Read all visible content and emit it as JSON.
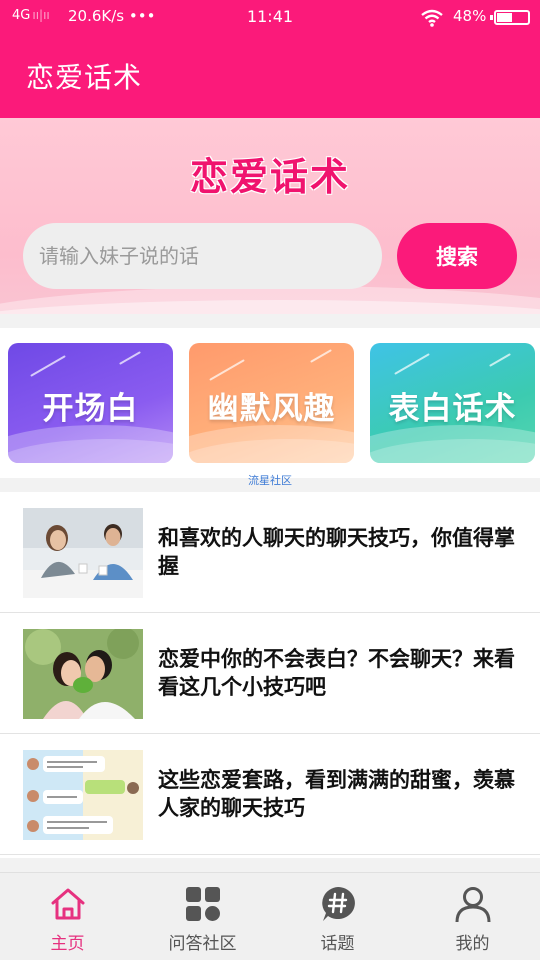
{
  "status_bar": {
    "network": "4G",
    "speed": "20.6K/s",
    "more": "•••",
    "time": "11:41",
    "battery": "48%"
  },
  "app_bar": {
    "title": "恋爱话术"
  },
  "banner": {
    "title": "恋爱话术",
    "search_placeholder": "请输入妹子说的话",
    "search_button": "搜索"
  },
  "categories": [
    {
      "label": "开场白",
      "color": "#7a52ea"
    },
    {
      "label": "幽默风趣",
      "color": "#ffa674"
    },
    {
      "label": "表白话术",
      "color": "#3cc6c4"
    }
  ],
  "ad_label": "流星社区",
  "articles": [
    {
      "title": "和喜欢的人聊天的聊天技巧，你值得掌握",
      "thumb_icon": "couple-cafe-photo"
    },
    {
      "title": "恋爱中你的不会表白？不会聊天？来看看这几个小技巧吧",
      "thumb_icon": "couple-kiss-photo"
    },
    {
      "title": "这些恋爱套路，看到满满的甜蜜，羡慕人家的聊天技巧",
      "thumb_icon": "chat-screenshot-photo"
    }
  ],
  "tabs": [
    {
      "label": "主页",
      "icon": "home-icon",
      "active": true
    },
    {
      "label": "问答社区",
      "icon": "grid-icon",
      "active": false
    },
    {
      "label": "话题",
      "icon": "hashtag-icon",
      "active": false
    },
    {
      "label": "我的",
      "icon": "person-icon",
      "active": false
    }
  ],
  "colors": {
    "brand": "#fb1a7a",
    "active_tab": "#e6317f",
    "banner_bg": "#ffc9d6"
  }
}
